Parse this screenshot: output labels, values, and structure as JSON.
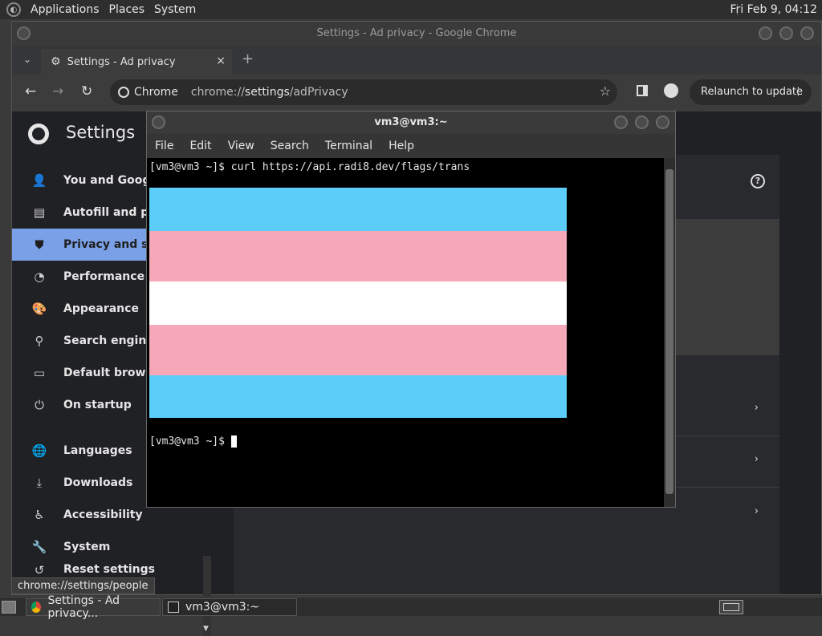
{
  "top_panel": {
    "menus": [
      "Applications",
      "Places",
      "System"
    ],
    "clock": "Fri Feb  9, 04:12"
  },
  "chrome": {
    "window_title": "Settings - Ad privacy - Google Chrome",
    "tab": {
      "title": "Settings - Ad privacy",
      "close": "×"
    },
    "new_tab": "+",
    "omnibox": {
      "chip_label": "Chrome",
      "url_prefix": "chrome://",
      "url_host": "settings",
      "url_path": "/adPrivacy"
    },
    "relaunch_label": "Relaunch to update",
    "settings_title": "Settings",
    "sidebar_items": [
      {
        "label": "You and Google",
        "icon": "person-icon"
      },
      {
        "label": "Autofill and passwords",
        "icon": "clipboard-icon"
      },
      {
        "label": "Privacy and security",
        "icon": "shield-icon"
      },
      {
        "label": "Performance",
        "icon": "speedometer-icon"
      },
      {
        "label": "Appearance",
        "icon": "palette-icon"
      },
      {
        "label": "Search engine",
        "icon": "search-icon"
      },
      {
        "label": "Default browser",
        "icon": "browser-icon"
      },
      {
        "label": "On startup",
        "icon": "power-icon"
      },
      {
        "label": "Languages",
        "icon": "globe-icon"
      },
      {
        "label": "Downloads",
        "icon": "download-icon"
      },
      {
        "label": "Accessibility",
        "icon": "accessibility-icon"
      },
      {
        "label": "System",
        "icon": "wrench-icon"
      },
      {
        "label": "Reset settings",
        "icon": "reset-icon"
      }
    ],
    "status_url": "chrome://settings/people"
  },
  "terminal": {
    "title": "vm3@vm3:~",
    "menus": [
      "File",
      "Edit",
      "View",
      "Search",
      "Terminal",
      "Help"
    ],
    "command_line": "[vm3@vm3 ~]$ curl https://api.radi8.dev/flags/trans",
    "prompt": "[vm3@vm3 ~]$ ",
    "flag_colors": [
      "#5bcdf8",
      "#f4a8b8",
      "#ffffff",
      "#f4a8b8",
      "#5bcdf8"
    ]
  },
  "taskbar": {
    "tasks": [
      "Settings - Ad privacy...",
      "vm3@vm3:~"
    ]
  }
}
